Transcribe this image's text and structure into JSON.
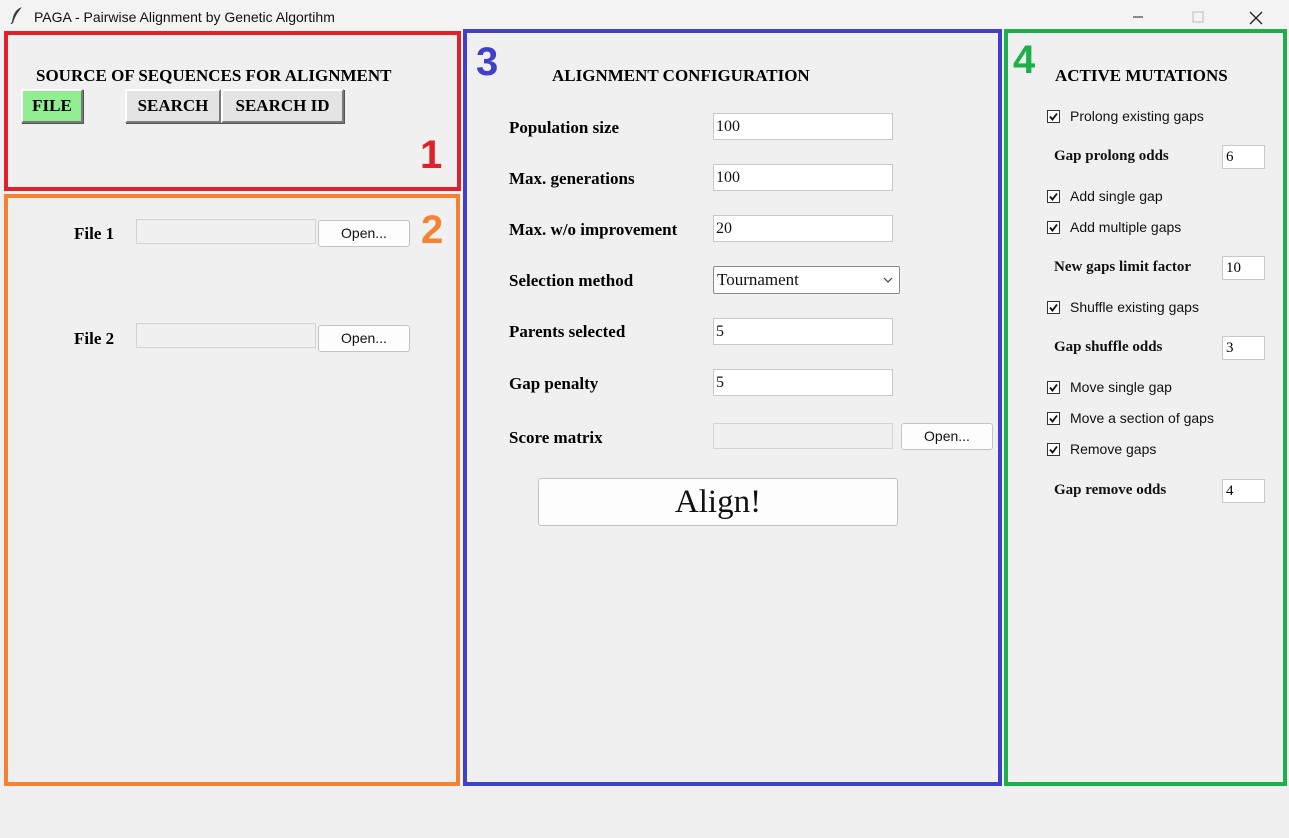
{
  "window": {
    "title": "PAGA - Pairwise Alignment by Genetic Algortihm"
  },
  "annotations": {
    "panel1": "1",
    "panel2": "2",
    "panel3": "3",
    "panel4": "4",
    "colors": {
      "panel1": "#e0202a",
      "panel2": "#f58232",
      "panel3": "#4040c8",
      "panel4": "#1db04a"
    }
  },
  "source": {
    "heading": "SOURCE OF SEQUENCES FOR ALIGNMENT",
    "buttons": {
      "file": "FILE",
      "search": "SEARCH",
      "search_id": "SEARCH ID"
    },
    "active_color": "#90ee90"
  },
  "files": {
    "file1_label": "File 1",
    "file1_value": "",
    "file1_open": "Open...",
    "file2_label": "File 2",
    "file2_value": "",
    "file2_open": "Open..."
  },
  "config": {
    "heading": "ALIGNMENT CONFIGURATION",
    "population_label": "Population size",
    "population_value": "100",
    "max_gen_label": "Max. generations",
    "max_gen_value": "100",
    "max_wo_label": "Max. w/o improvement",
    "max_wo_value": "20",
    "selection_label": "Selection method",
    "selection_value": "Tournament",
    "parents_label": "Parents selected",
    "parents_value": "5",
    "gap_penalty_label": "Gap penalty",
    "gap_penalty_value": "5",
    "score_matrix_label": "Score matrix",
    "score_matrix_value": "",
    "score_matrix_open": "Open...",
    "align_button": "Align!"
  },
  "mutations": {
    "heading": "ACTIVE MUTATIONS",
    "prolong_gaps": "Prolong existing gaps",
    "prolong_checked": true,
    "gap_prolong_odds_label": "Gap prolong odds",
    "gap_prolong_odds_value": "6",
    "add_single_gap": "Add single gap",
    "add_single_checked": true,
    "add_multiple_gaps": "Add multiple gaps",
    "add_multiple_checked": true,
    "new_gaps_limit_label": "New gaps limit factor",
    "new_gaps_limit_value": "10",
    "shuffle_gaps": "Shuffle existing gaps",
    "shuffle_checked": true,
    "gap_shuffle_odds_label": "Gap shuffle odds",
    "gap_shuffle_odds_value": "3",
    "move_single_gap": "Move single gap",
    "move_single_checked": true,
    "move_section": "Move a section of gaps",
    "move_section_checked": true,
    "remove_gaps": "Remove gaps",
    "remove_checked": true,
    "gap_remove_odds_label": "Gap remove odds",
    "gap_remove_odds_value": "4"
  }
}
